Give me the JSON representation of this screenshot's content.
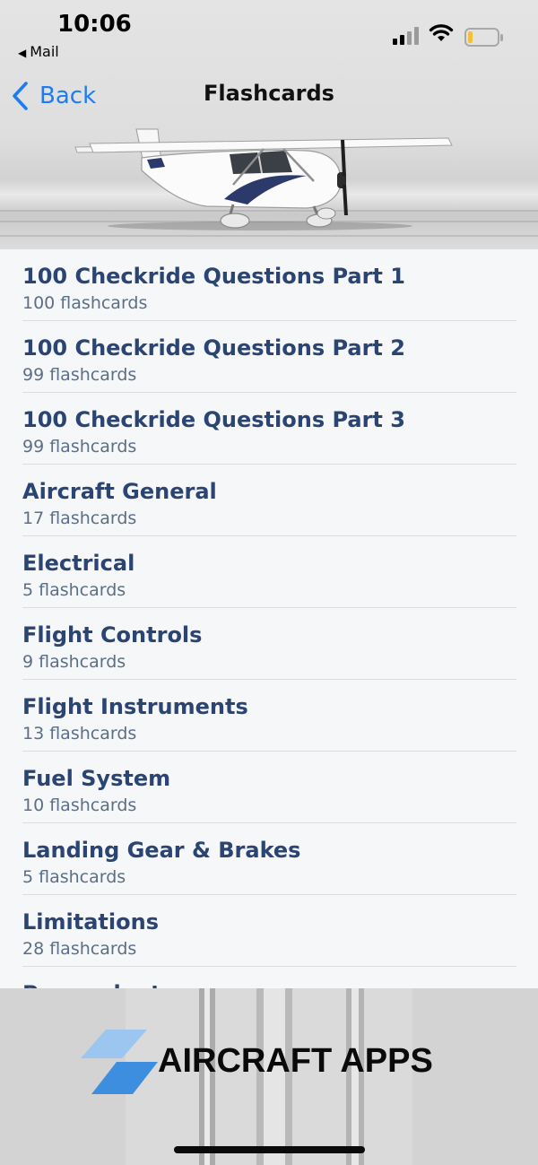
{
  "status_bar": {
    "time": "10:06",
    "back_app": "Mail",
    "icons": [
      "signal-icon",
      "wifi-icon",
      "battery-icon"
    ]
  },
  "nav": {
    "back_label": "Back",
    "title": "Flashcards"
  },
  "colors": {
    "accent": "#1e7cf2",
    "title_text": "#2a4474",
    "subtitle_text": "#5d6f86",
    "list_bg": "#f5f7f9"
  },
  "list": {
    "items": [
      {
        "title": "100 Checkride Questions Part 1",
        "subtitle": "100 flashcards"
      },
      {
        "title": "100 Checkride Questions Part 2",
        "subtitle": "99 flashcards"
      },
      {
        "title": "100 Checkride Questions Part 3",
        "subtitle": "99 flashcards"
      },
      {
        "title": "Aircraft General",
        "subtitle": "17 flashcards"
      },
      {
        "title": "Electrical",
        "subtitle": "5 flashcards"
      },
      {
        "title": "Flight Controls",
        "subtitle": "9 flashcards"
      },
      {
        "title": "Flight Instruments",
        "subtitle": "13 flashcards"
      },
      {
        "title": "Fuel System",
        "subtitle": "10 flashcards"
      },
      {
        "title": "Landing Gear & Brakes",
        "subtitle": "5 flashcards"
      },
      {
        "title": "Limitations",
        "subtitle": "28 flashcards"
      },
      {
        "title": "Powerplant",
        "subtitle": ""
      }
    ]
  },
  "footer": {
    "brand": "AIRCRAFT APPS"
  }
}
